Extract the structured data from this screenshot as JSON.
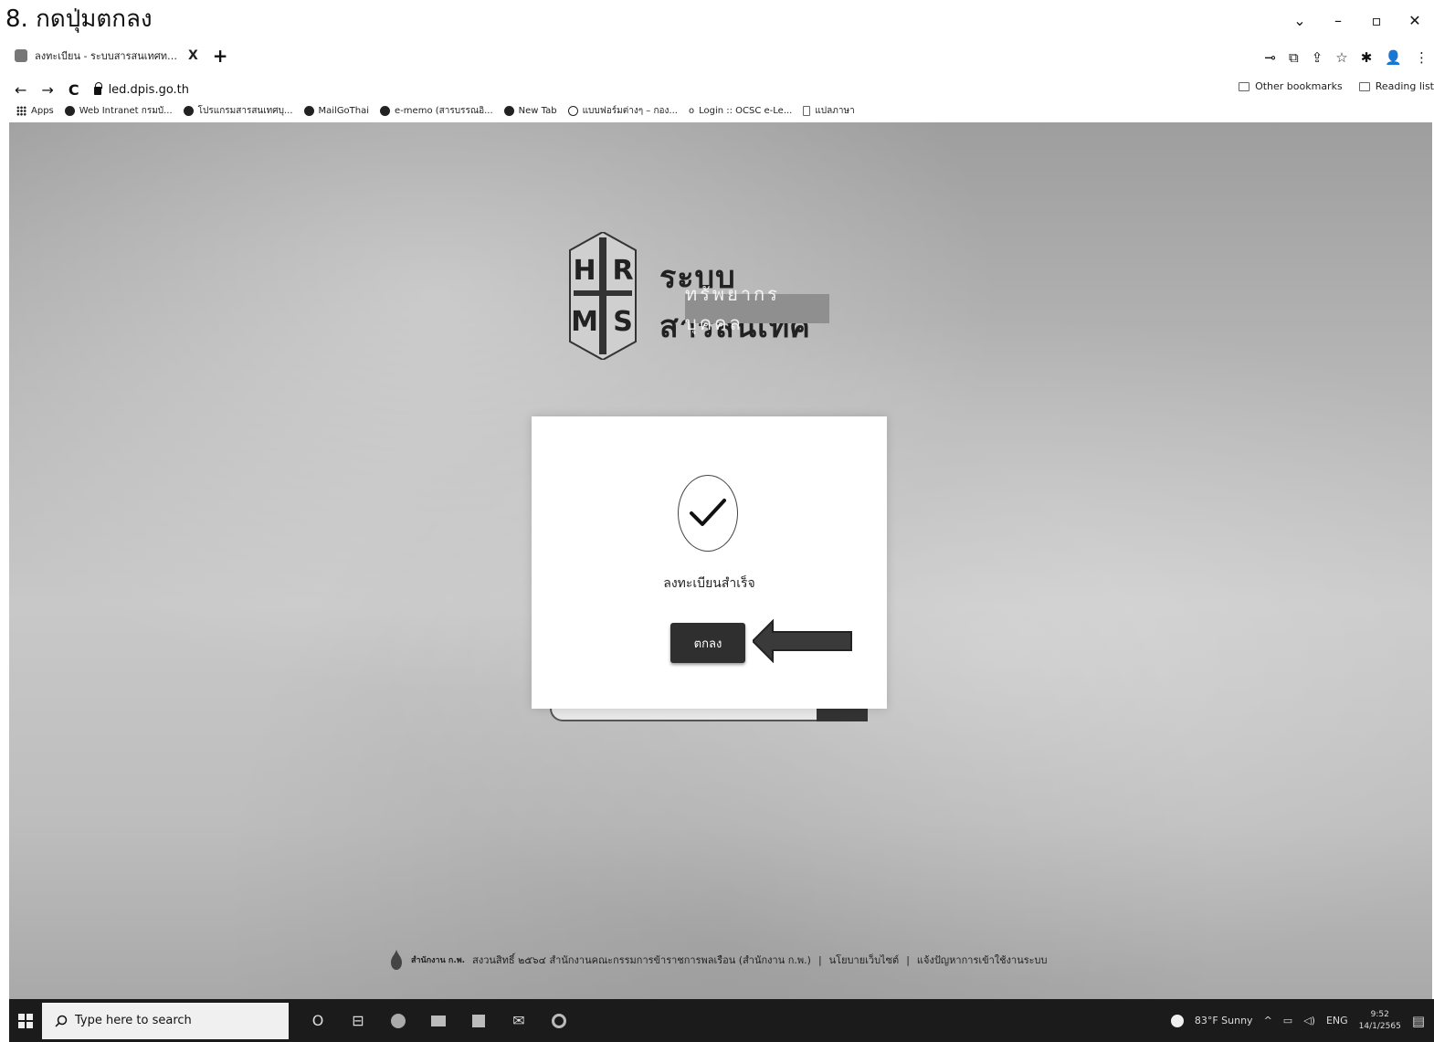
{
  "doc_heading": "8. กดปุ่มตกลง",
  "window_controls": {
    "dropdown": "⌄",
    "minimize": "–",
    "restore": "▫",
    "close": "✕"
  },
  "tab": {
    "title": "ลงทะเบียน - ระบบสารสนเทศทรัพยากร",
    "close": "X",
    "new_tab": "+"
  },
  "address": {
    "back": "←",
    "forward": "→",
    "reload": "C",
    "url": "led.dpis.go.th"
  },
  "extensions": [
    "⊸",
    "⧉",
    "⇪",
    "☆",
    "✱",
    "👤",
    "⋮"
  ],
  "right_bookmarks": {
    "other": "Other bookmarks",
    "reading_list": "Reading list"
  },
  "bookmarks": [
    "Apps",
    "Web Intranet กรมบั...",
    "โปรแกรมสารสนเทศบุ...",
    "MailGoThai",
    "e-memo (สารบรรณอิ...",
    "New Tab",
    "แบบฟอร์มต่างๆ – กอง...",
    "Login :: OCSC e-Le...",
    "แปลภาษา"
  ],
  "logo": {
    "letters": [
      "H",
      "R",
      "M",
      "S"
    ],
    "title": "ระบบสารสนเทศ",
    "subtitle": "ทรัพยากรบุคคล"
  },
  "modal": {
    "message": "ลงทะเบียนสำเร็จ",
    "ok_label": "ตกลง"
  },
  "footer": {
    "brand": "สำนักงาน ก.พ.",
    "copyright": "สงวนสิทธิ์ ๒๕๖๔ สำนักงานคณะกรรมการข้าราชการพลเรือน (สำนักงาน ก.พ.)",
    "sep": "|",
    "policy": "นโยบายเว็บไซต์",
    "report": "แจ้งปัญหาการเข้าใช้งานระบบ"
  },
  "taskbar": {
    "search_placeholder": "Type here to search",
    "weather": "83°F Sunny",
    "lang": "ENG",
    "time": "9:52",
    "date": "14/1/2565"
  },
  "colors": {
    "modal_button": "#2f2f2f",
    "taskbar": "#1b1b1b"
  }
}
